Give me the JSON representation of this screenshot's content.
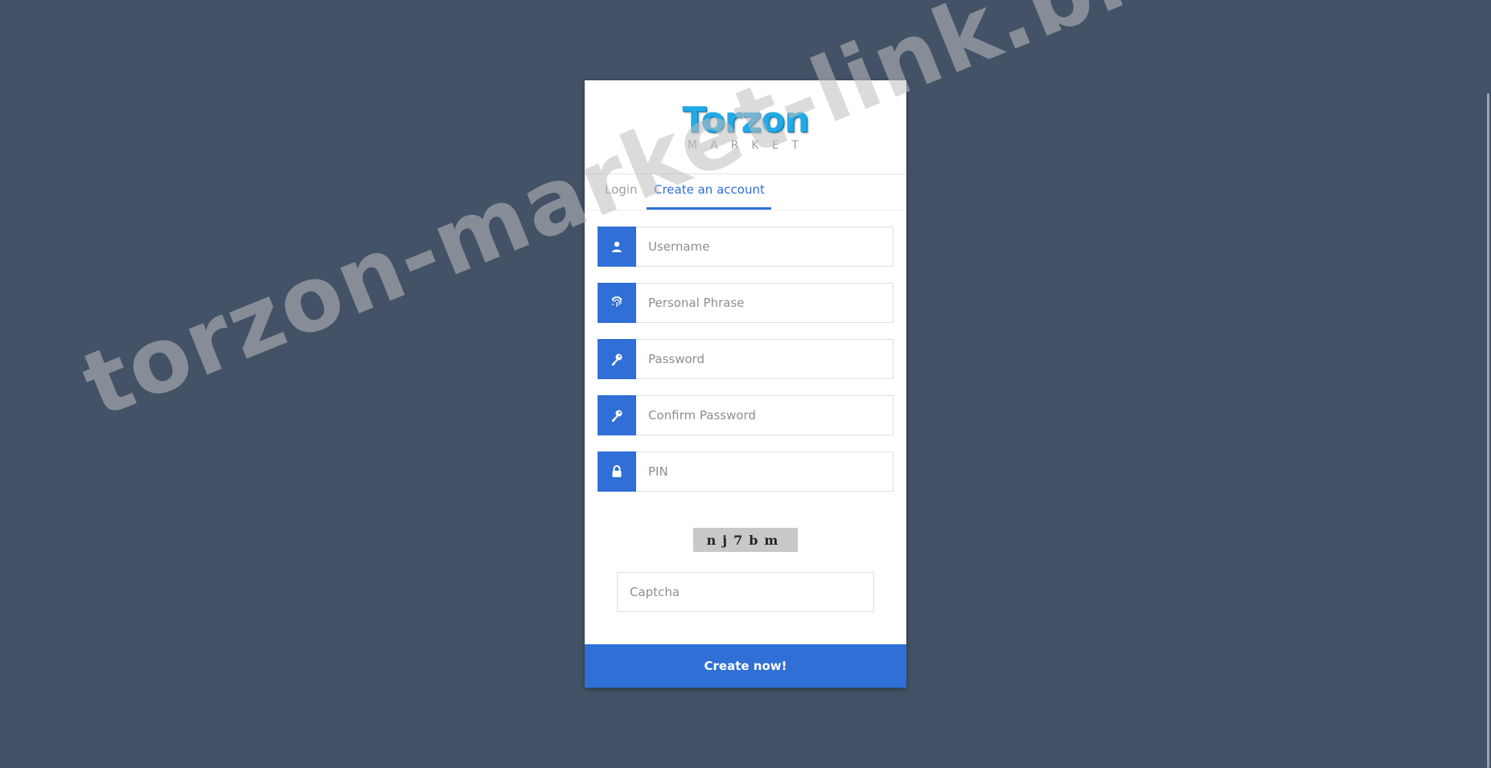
{
  "logo": {
    "word": "Torzon",
    "sub": "MARKET"
  },
  "tabs": [
    {
      "label": "Login",
      "active": false
    },
    {
      "label": "Create an account",
      "active": true
    }
  ],
  "form": {
    "fields": [
      {
        "placeholder": "Username",
        "icon": "user-icon"
      },
      {
        "placeholder": "Personal Phrase",
        "icon": "fingerprint-icon"
      },
      {
        "placeholder": "Password",
        "icon": "key-icon"
      },
      {
        "placeholder": "Confirm Password",
        "icon": "key-icon"
      },
      {
        "placeholder": "PIN",
        "icon": "lock-icon"
      }
    ],
    "captcha_text": "nj7bm",
    "captcha_placeholder": "Captcha",
    "submit_label": "Create now!"
  },
  "watermark": "torzon-market-link.biz",
  "colors": {
    "background": "#435266",
    "accent": "#2f6fd6",
    "card": "#ffffff"
  }
}
